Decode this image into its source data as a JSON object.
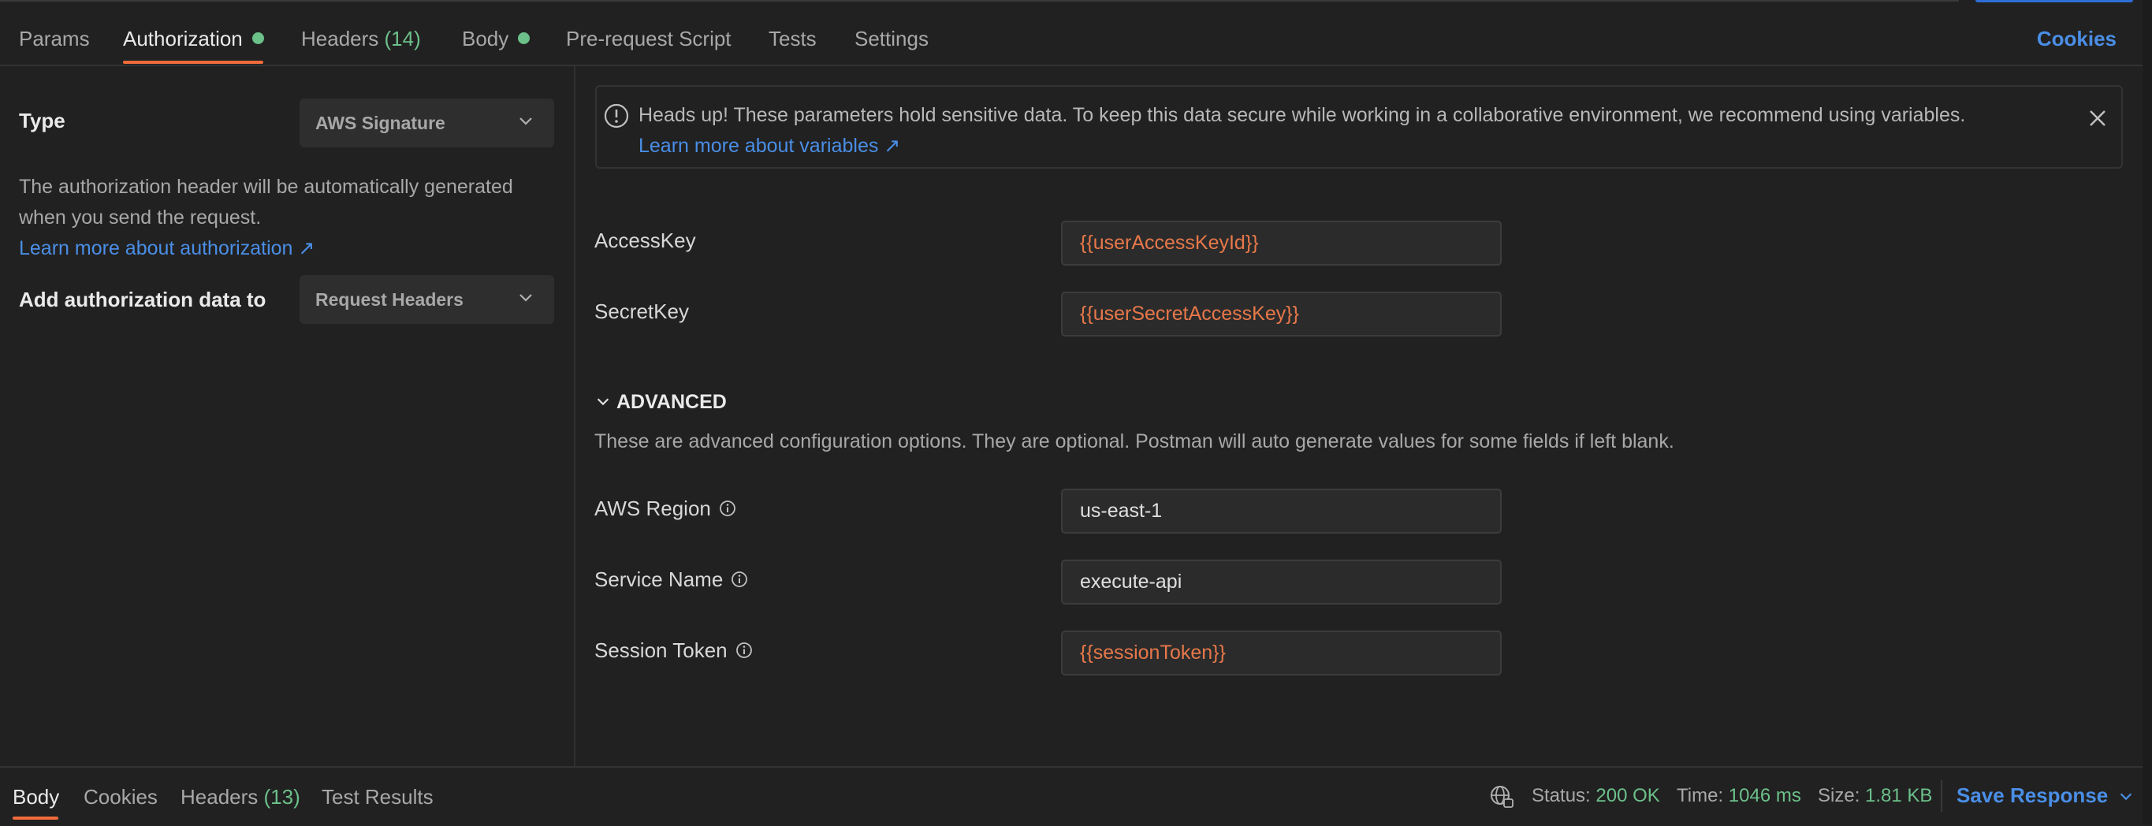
{
  "tabs": {
    "params": "Params",
    "authorization": "Authorization",
    "headers": "Headers",
    "headers_count": "(14)",
    "body": "Body",
    "pre_request": "Pre-request Script",
    "tests": "Tests",
    "settings": "Settings",
    "cookies": "Cookies"
  },
  "auth": {
    "type_label": "Type",
    "type_value": "AWS Signature",
    "description": "The authorization header will be automatically generated when you send the request.",
    "learn_more": "Learn more about authorization ↗",
    "add_to_label": "Add authorization data to",
    "add_to_value": "Request Headers"
  },
  "banner": {
    "message": "Heads up! These parameters hold sensitive data. To keep this data secure while working in a collaborative environment, we recommend using variables.",
    "link": "Learn more about variables ↗"
  },
  "fields": {
    "access_key_label": "AccessKey",
    "access_key_value": "{{userAccessKeyId}}",
    "secret_key_label": "SecretKey",
    "secret_key_value": "{{userSecretAccessKey}}"
  },
  "advanced": {
    "title": "ADVANCED",
    "description": "These are advanced configuration options. They are optional. Postman will auto generate values for some fields if left blank.",
    "region_label": "AWS Region",
    "region_value": "us-east-1",
    "service_label": "Service Name",
    "service_value": "execute-api",
    "token_label": "Session Token",
    "token_value": "{{sessionToken}}"
  },
  "response": {
    "body": "Body",
    "cookies": "Cookies",
    "headers": "Headers",
    "headers_count": "(13)",
    "test_results": "Test Results",
    "status_label": "Status:",
    "status_value": "200 OK",
    "time_label": "Time:",
    "time_value": "1046 ms",
    "size_label": "Size:",
    "size_value": "1.81 KB",
    "save_response": "Save Response"
  },
  "colors": {
    "accent": "#f26b3a",
    "link": "#4a8ee6",
    "success": "#6cc08a",
    "variable": "#e8784a"
  }
}
